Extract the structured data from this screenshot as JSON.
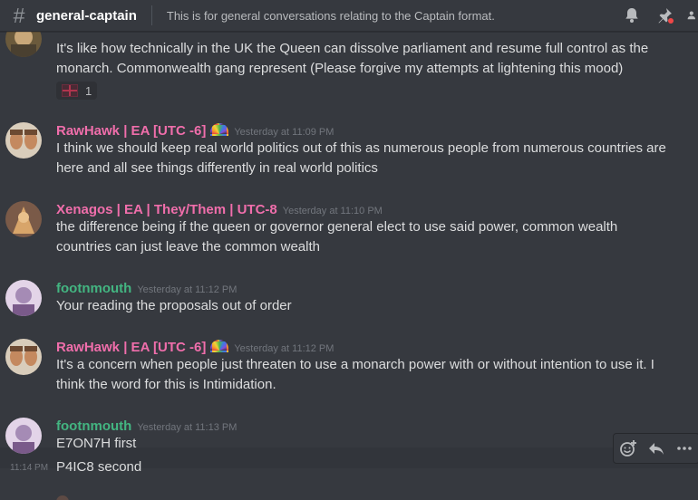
{
  "channel": {
    "name": "general-captain",
    "topic": "This is for general conversations relating to the Captain format."
  },
  "header_icons": [
    "bell-icon",
    "pin-icon",
    "members-icon"
  ],
  "messages": [
    {
      "continued": true,
      "lines": [
        "It's like how technically in the UK the Queen can dissolve parliament and resume full control as the",
        "monarch. Commonwealth gang represent (Please forgive my attempts at lightening this mood)"
      ],
      "reaction": {
        "emoji": "flag-gb",
        "count": "1"
      }
    },
    {
      "author": "RawHawk | EA [UTC -6]",
      "author_color": "#f06eab",
      "badge": "rainbow-emoji",
      "timestamp": "Yesterday at 11:09 PM",
      "lines": [
        "I think we should keep real world politics out of this as numerous people from numerous countries are",
        "here and all see things differently in real world politics"
      ]
    },
    {
      "author": "Xenagos | EA | They/Them | UTC-8",
      "author_color": "#f06eab",
      "timestamp": "Yesterday at 11:10 PM",
      "lines": [
        "the difference being if the queen or governor general elect to use said power, common wealth",
        "countries can just leave the common wealth"
      ]
    },
    {
      "author": "footnmouth",
      "author_color": "#43b581",
      "timestamp": "Yesterday at 11:12 PM",
      "lines": [
        "Your reading the proposals out of order"
      ]
    },
    {
      "author": "RawHawk | EA [UTC -6]",
      "author_color": "#f06eab",
      "badge": "rainbow-emoji",
      "timestamp": "Yesterday at 11:12 PM",
      "lines": [
        "It's a concern when people just threaten to use a monarch power with or without intention to use it. I",
        "think the word for this is Intimidation."
      ]
    },
    {
      "author": "footnmouth",
      "author_color": "#43b581",
      "timestamp": "Yesterday at 11:13 PM",
      "lines": [
        "E7ON7H first"
      ],
      "followup": {
        "timestamp": "11:14 PM",
        "text": "P4IC8 second"
      }
    }
  ],
  "hover_toolbar": [
    "add-reaction-icon",
    "reply-icon",
    "more-icon"
  ]
}
